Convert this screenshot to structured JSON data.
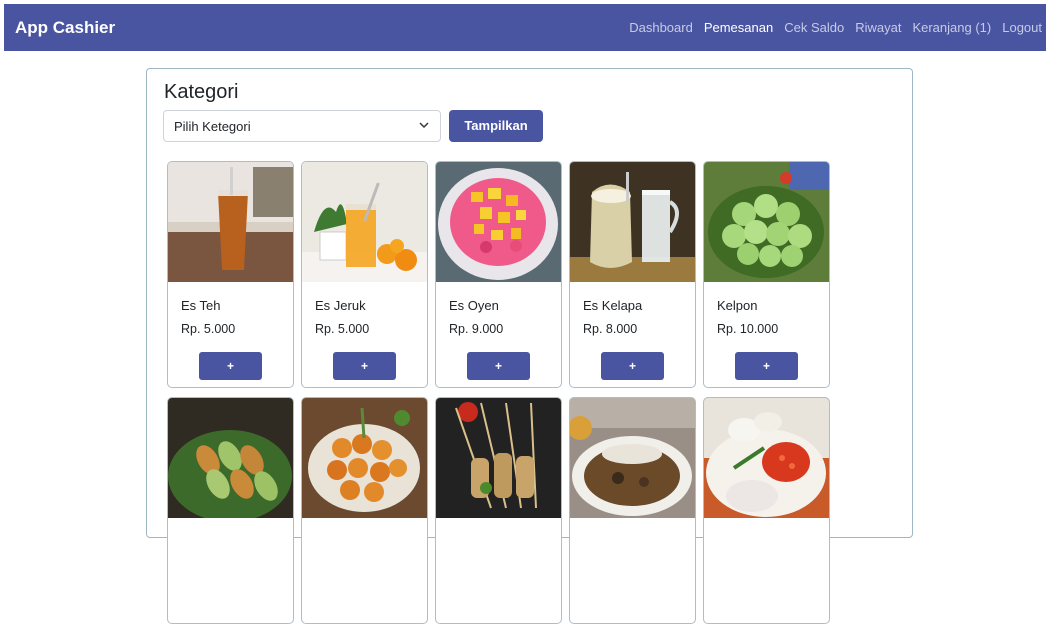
{
  "navbar": {
    "brand": "App Cashier",
    "links": [
      {
        "label": "Dashboard",
        "active": false
      },
      {
        "label": "Pemesanan",
        "active": true
      },
      {
        "label": "Cek Saldo",
        "active": false
      },
      {
        "label": "Riwayat",
        "active": false
      },
      {
        "label": "Keranjang (1)",
        "active": false
      },
      {
        "label": "Logout",
        "active": false
      }
    ]
  },
  "filter": {
    "title": "Kategori",
    "select_value": "Pilih Ketegori",
    "button_label": "Tampilkan"
  },
  "products": [
    {
      "name": "Es Teh",
      "price": "Rp. 5.000",
      "add_label": "+",
      "image": "iced-tea-image"
    },
    {
      "name": "Es Jeruk",
      "price": "Rp. 5.000",
      "add_label": "+",
      "image": "orange-juice-image"
    },
    {
      "name": "Es Oyen",
      "price": "Rp. 9.000",
      "add_label": "+",
      "image": "es-oyen-image"
    },
    {
      "name": "Es Kelapa",
      "price": "Rp. 8.000",
      "add_label": "+",
      "image": "coconut-drink-image"
    },
    {
      "name": "Kelpon",
      "price": "Rp. 10.000",
      "add_label": "+",
      "image": "klepon-image"
    },
    {
      "name": "",
      "price": "",
      "add_label": "",
      "image": "kue-image"
    },
    {
      "name": "",
      "price": "",
      "add_label": "",
      "image": "cilok-image"
    },
    {
      "name": "",
      "price": "",
      "add_label": "",
      "image": "sate-image"
    },
    {
      "name": "",
      "price": "",
      "add_label": "",
      "image": "soup-image"
    },
    {
      "name": "",
      "price": "",
      "add_label": "",
      "image": "sambal-image"
    }
  ],
  "colors": {
    "primary": "#4a55a2",
    "nav_inactive": "#c7cbe6",
    "card_border": "#a9bfcc"
  }
}
